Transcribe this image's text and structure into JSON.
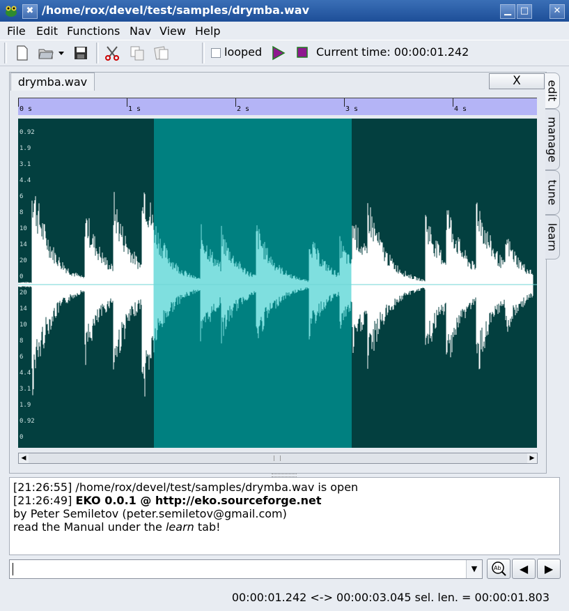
{
  "window": {
    "title": "/home/rox/devel/test/samples/drymba.wav"
  },
  "menu": [
    "File",
    "Edit",
    "Functions",
    "Nav",
    "View",
    "Help"
  ],
  "toolbar": {
    "looped_label": "looped",
    "looped_checked": false,
    "current_time_label": "Current time: 00:00:01.242"
  },
  "tab": {
    "filename": "drymba.wav",
    "close_label": "X"
  },
  "side_tabs": [
    "edit",
    "manage",
    "tune",
    "learn"
  ],
  "ruler": {
    "ticks": [
      "0 s",
      "1 s",
      "2 s",
      "3 s",
      "4 s"
    ]
  },
  "amp_labels": [
    "0.92",
    "1.9",
    "3.1",
    "4.4",
    "6",
    "8",
    "10",
    "14",
    "20",
    "0",
    "20",
    "14",
    "10",
    "8",
    "6",
    "4.4",
    "3.1",
    "1.9",
    "0.92",
    "0"
  ],
  "selection": {
    "start": "00:00:01.242",
    "end": "00:00:03.045"
  },
  "log": {
    "line1": "[21:26:55] /home/rox/devel/test/samples/drymba.wav is open",
    "line2_time": "[21:26:49] ",
    "line2_bold": "EKO 0.0.1 @ http://eko.sourceforge.net",
    "line3": "by Peter Semiletov (peter.semiletov@gmail.com)",
    "line4_a": "read the Manual under the ",
    "line4_em": "learn",
    "line4_b": " tab!"
  },
  "command": {
    "value": ""
  },
  "status": "00:00:01.242 <-> 00:00:03.045 sel. len. = 00:00:01.803",
  "colors": {
    "waveform_bg": "#033f3f",
    "selection_bg": "#008080",
    "wave": "#ffffff",
    "wave_selected": "#7fdfdf",
    "ruler_bg": "#b4b4f6"
  }
}
